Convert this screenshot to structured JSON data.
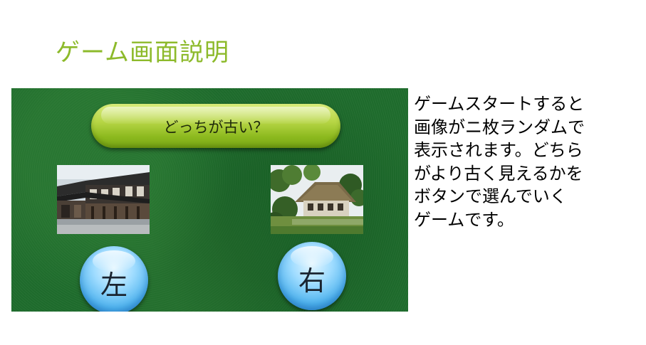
{
  "slide": {
    "title": "ゲーム画面説明"
  },
  "game": {
    "question": "どっちが古い？",
    "left_photo": "old-townhouse-photo",
    "right_photo": "thatched-farmhouse-photo",
    "left_button_label": "左",
    "right_button_label": "右"
  },
  "description": {
    "lines": [
      "ゲームスタートすると",
      "画像がニ枚ランダムで",
      "表示されます。どちら",
      "がより古く見えるかを",
      "ボタンで選んでいく",
      "ゲームです。"
    ]
  },
  "colors": {
    "title": "#8dba2b",
    "background_felt": "#1e6b2c",
    "banner": "#b7d646",
    "button": "#4eb3ee"
  }
}
